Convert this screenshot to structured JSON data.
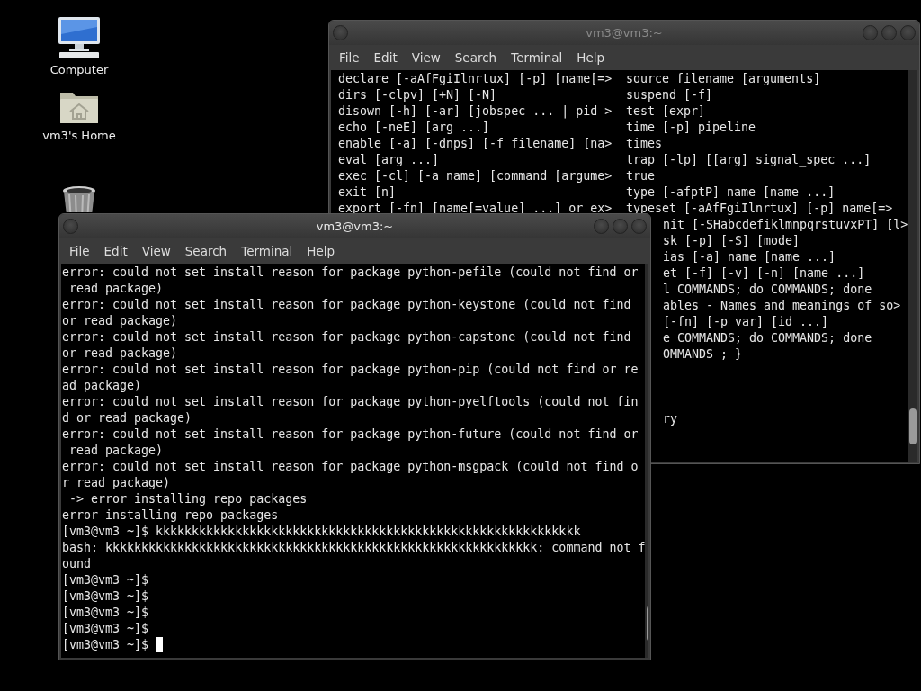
{
  "desktop_icons": [
    {
      "kind": "computer",
      "label": "Computer"
    },
    {
      "kind": "home",
      "label": "vm3's Home"
    },
    {
      "kind": "trash"
    }
  ],
  "windows": [
    {
      "title": "vm3@vm3:~",
      "focused": false,
      "menu": [
        "File",
        "Edit",
        "View",
        "Search",
        "Terminal",
        "Help"
      ],
      "rows": [
        {
          "left": "declare [-aAfFgiIlnrtux] [-p] [name[=>",
          "right": "source filename [arguments]"
        },
        {
          "left": "dirs [-clpv] [+N] [-N]",
          "right": "suspend [-f]"
        },
        {
          "left": "disown [-h] [-ar] [jobspec ... | pid >",
          "right": "test [expr]"
        },
        {
          "left": "echo [-neE] [arg ...]",
          "right": "time [-p] pipeline"
        },
        {
          "left": "enable [-a] [-dnps] [-f filename] [na>",
          "right": "times"
        },
        {
          "left": "eval [arg ...]",
          "right": "trap [-lp] [[arg] signal_spec ...]"
        },
        {
          "left": "exec [-cl] [-a name] [command [argume>",
          "right": "true"
        },
        {
          "left": "exit [n]",
          "right": "type [-afptP] name [name ...]"
        },
        {
          "left": "export [-fn] [name[=value] ...] or ex>",
          "right": "typeset [-aAfFgiIlnrtux] [-p] name[=>"
        }
      ],
      "partial_rows": [
        {
          "kind": "text",
          "text": "nit [-SHabcdefiklmnpqrstuvxPT] [l>"
        },
        {
          "kind": "text",
          "text": "sk [-p] [-S] [mode]"
        },
        {
          "kind": "text",
          "text": "ias [-a] name [name ...]"
        },
        {
          "kind": "text",
          "text": "et [-f] [-v] [-n] [name ...]"
        },
        {
          "kind": "text",
          "text": "l COMMANDS; do COMMANDS; done"
        },
        {
          "kind": "text",
          "text": "ables - Names and meanings of so>"
        },
        {
          "kind": "text",
          "text": "[-fn] [-p var] [id ...]"
        },
        {
          "kind": "text",
          "text": "e COMMANDS; do COMMANDS; done"
        },
        {
          "kind": "text",
          "text": "OMMANDS ; }"
        },
        {
          "kind": "blank"
        },
        {
          "kind": "blank"
        },
        {
          "kind": "blank"
        },
        {
          "kind": "text",
          "text": "ry"
        }
      ]
    },
    {
      "title": "vm3@vm3:~",
      "focused": true,
      "menu": [
        "File",
        "Edit",
        "View",
        "Search",
        "Terminal",
        "Help"
      ],
      "lines": [
        "error: could not set install reason for package python-pefile (could not find or",
        " read package)",
        "error: could not set install reason for package python-keystone (could not find",
        "or read package)",
        "error: could not set install reason for package python-capstone (could not find",
        "or read package)",
        "error: could not set install reason for package python-pip (could not find or re",
        "ad package)",
        "error: could not set install reason for package python-pyelftools (could not fin",
        "d or read package)",
        "error: could not set install reason for package python-future (could not find or",
        " read package)",
        "error: could not set install reason for package python-msgpack (could not find o",
        "r read package)",
        " -> error installing repo packages",
        "error installing repo packages",
        "[vm3@vm3 ~]$ kkkkkkkkkkkkkkkkkkkkkkkkkkkkkkkkkkkkkkkkkkkkkkkkkkkkkkkkkkk",
        "bash: kkkkkkkkkkkkkkkkkkkkkkkkkkkkkkkkkkkkkkkkkkkkkkkkkkkkkkkkkkkk: command not f",
        "ound",
        "[vm3@vm3 ~]$",
        "[vm3@vm3 ~]$",
        "[vm3@vm3 ~]$",
        "[vm3@vm3 ~]$",
        "[vm3@vm3 ~]$"
      ],
      "cursor": true
    }
  ]
}
